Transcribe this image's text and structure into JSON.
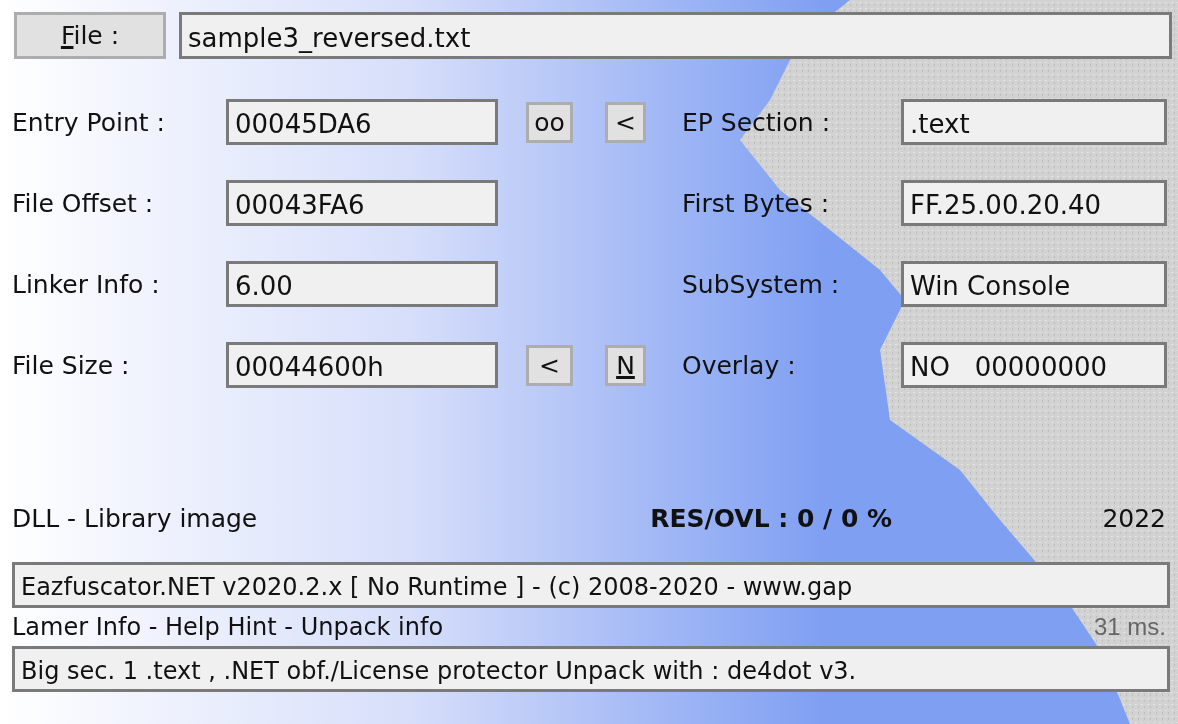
{
  "file_button": {
    "label": "File :",
    "mnemonic": true
  },
  "file_path": "sample3_reversed.txt",
  "rows": [
    {
      "label": "Entry Point :",
      "value": "00045DA6",
      "buttons": [
        {
          "label": "oo",
          "mnemonic": false
        },
        {
          "label": "<",
          "mnemonic": false
        }
      ],
      "right_label": "EP Section :",
      "right_value": ".text"
    },
    {
      "label": "File Offset :",
      "value": "00043FA6",
      "buttons": [],
      "right_label": "First Bytes :",
      "right_value": "FF.25.00.20.40"
    },
    {
      "label": "Linker Info :",
      "value": "6.00",
      "buttons": [],
      "right_label": "SubSystem :",
      "right_value": "Win Console"
    },
    {
      "label": "File Size :",
      "value": "00044600h",
      "buttons": [
        {
          "label": "<",
          "mnemonic": false
        },
        {
          "label": "N",
          "mnemonic": true
        }
      ],
      "right_label": "Overlay :",
      "right_value": "NO   00000000"
    }
  ],
  "image_type": "DLL - Library image",
  "res_ovl": "RES/OVL : 0 / 0 %",
  "year": "2022",
  "detection": "Eazfuscator.NET v2020.2.x [ No Runtime ] - (c) 2008-2020 - www.gap",
  "info_links": "Lamer Info - Help Hint - Unpack info",
  "scan_time": "31 ms.",
  "hint": "Big sec. 1 .text , .NET obf./License protector Unpack with : de4dot v3."
}
